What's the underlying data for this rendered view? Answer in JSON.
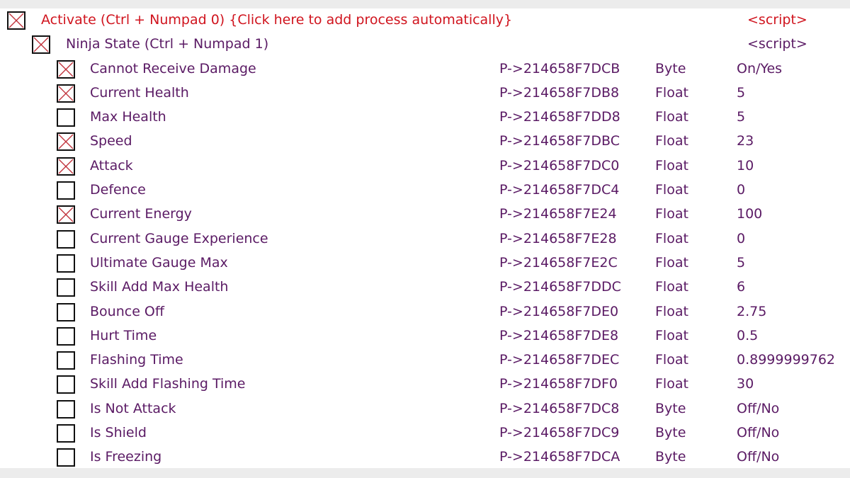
{
  "colors": {
    "script_header": "#d0141e",
    "entry": "#5a1a64",
    "check_mark": "#c0303a"
  },
  "rows": [
    {
      "level": 0,
      "checked": true,
      "red": true,
      "description": "Activate (Ctrl + Numpad 0) {Click here to add process automatically}",
      "address": "",
      "type": "",
      "value": "<script>"
    },
    {
      "level": 1,
      "checked": true,
      "red": false,
      "description": "Ninja State (Ctrl + Numpad 1)",
      "address": "",
      "type": "",
      "value": "<script>"
    },
    {
      "level": 2,
      "checked": true,
      "description": "Cannot Receive Damage",
      "address": "P->214658F7DCB",
      "type": "Byte",
      "value": "On/Yes"
    },
    {
      "level": 2,
      "checked": true,
      "description": "Current Health",
      "address": "P->214658F7DB8",
      "type": "Float",
      "value": "5"
    },
    {
      "level": 2,
      "checked": false,
      "description": "Max Health",
      "address": "P->214658F7DD8",
      "type": "Float",
      "value": "5"
    },
    {
      "level": 2,
      "checked": true,
      "description": "Speed",
      "address": "P->214658F7DBC",
      "type": "Float",
      "value": "23"
    },
    {
      "level": 2,
      "checked": true,
      "description": "Attack",
      "address": "P->214658F7DC0",
      "type": "Float",
      "value": "10"
    },
    {
      "level": 2,
      "checked": false,
      "description": "Defence",
      "address": "P->214658F7DC4",
      "type": "Float",
      "value": "0"
    },
    {
      "level": 2,
      "checked": true,
      "description": "Current Energy",
      "address": "P->214658F7E24",
      "type": "Float",
      "value": "100"
    },
    {
      "level": 2,
      "checked": false,
      "description": "Current Gauge Experience",
      "address": "P->214658F7E28",
      "type": "Float",
      "value": "0"
    },
    {
      "level": 2,
      "checked": false,
      "description": "Ultimate Gauge Max",
      "address": "P->214658F7E2C",
      "type": "Float",
      "value": "5"
    },
    {
      "level": 2,
      "checked": false,
      "description": "Skill Add Max Health",
      "address": "P->214658F7DDC",
      "type": "Float",
      "value": "6"
    },
    {
      "level": 2,
      "checked": false,
      "description": "Bounce Off",
      "address": "P->214658F7DE0",
      "type": "Float",
      "value": "2.75"
    },
    {
      "level": 2,
      "checked": false,
      "description": "Hurt Time",
      "address": "P->214658F7DE8",
      "type": "Float",
      "value": "0.5"
    },
    {
      "level": 2,
      "checked": false,
      "description": "Flashing Time",
      "address": "P->214658F7DEC",
      "type": "Float",
      "value": "0.8999999762"
    },
    {
      "level": 2,
      "checked": false,
      "description": "Skill Add Flashing Time",
      "address": "P->214658F7DF0",
      "type": "Float",
      "value": "30"
    },
    {
      "level": 2,
      "checked": false,
      "description": "Is Not Attack",
      "address": "P->214658F7DC8",
      "type": "Byte",
      "value": "Off/No"
    },
    {
      "level": 2,
      "checked": false,
      "description": "Is Shield",
      "address": "P->214658F7DC9",
      "type": "Byte",
      "value": "Off/No"
    },
    {
      "level": 2,
      "checked": false,
      "description": "Is Freezing",
      "address": "P->214658F7DCA",
      "type": "Byte",
      "value": "Off/No"
    }
  ]
}
